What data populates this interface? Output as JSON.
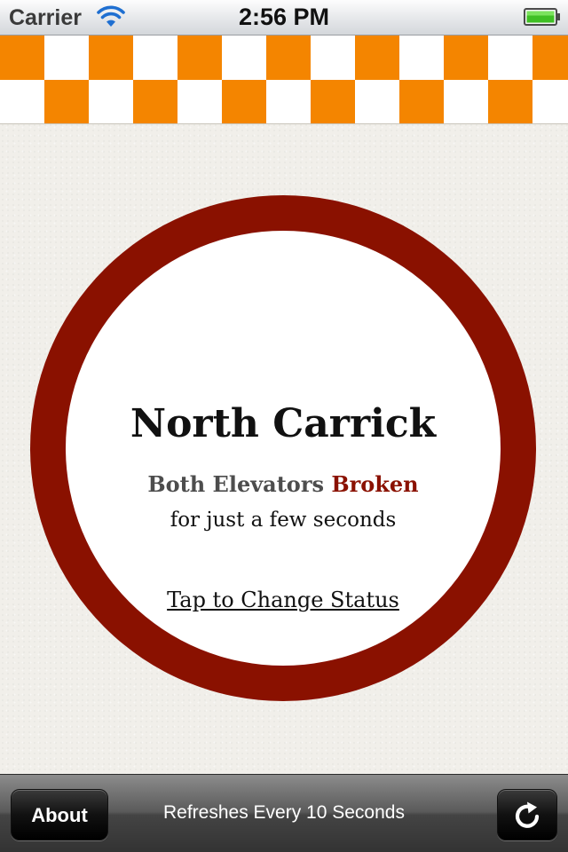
{
  "status_bar": {
    "carrier": "Carrier",
    "time": "2:56 PM",
    "wifi_icon": "wifi-icon",
    "battery_icon": "battery-icon",
    "battery_level": 1.0
  },
  "banner": {
    "colors": [
      "#f48500",
      "#ffffff"
    ]
  },
  "status_card": {
    "building": "North Carrick",
    "subject": "Both Elevators",
    "condition": "Broken",
    "duration": "for just a few seconds",
    "tap_label": "Tap to Change Status",
    "ring_color": "#8a1100"
  },
  "toolbar": {
    "about_label": "About",
    "refresh_caption": "Refreshes Every 10 Seconds",
    "refresh_icon": "refresh-icon"
  }
}
